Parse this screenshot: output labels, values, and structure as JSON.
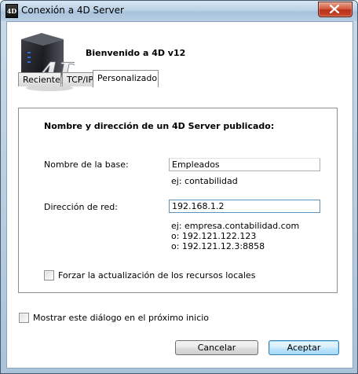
{
  "window": {
    "title": "Conexión a 4D Server",
    "app_icon_text": "4D"
  },
  "header": {
    "welcome": "Bienvenido a 4D v12",
    "logo_text": "4D"
  },
  "tabs": [
    {
      "label": "Reciente",
      "active": false
    },
    {
      "label": "TCP/IP",
      "active": false
    },
    {
      "label": "Personalizado",
      "active": true
    }
  ],
  "custom": {
    "heading": "Nombre y dirección de un 4D Server publicado:",
    "db_name_label": "Nombre de la base:",
    "db_name_value": "Empleados",
    "db_name_hint": "ej: contabilidad",
    "address_label": "Dirección de red:",
    "address_value": "192.168.1.2",
    "address_hints": [
      "ej: empresa.contabilidad.com",
      "o: 192.121.122.123",
      "o: 192.121.12.3:8858"
    ],
    "force_update_label": "Forzar la actualización de los recursos locales",
    "force_update_checked": false
  },
  "footer": {
    "show_dialog_label": "Mostrar este diálogo en el próximo inicio",
    "show_dialog_checked": false,
    "cancel_label": "Cancelar",
    "accept_label": "Aceptar"
  },
  "colors": {
    "titlebar": "#bcd2e6",
    "close_button": "#c9492c",
    "default_button": "#bee6fd"
  }
}
